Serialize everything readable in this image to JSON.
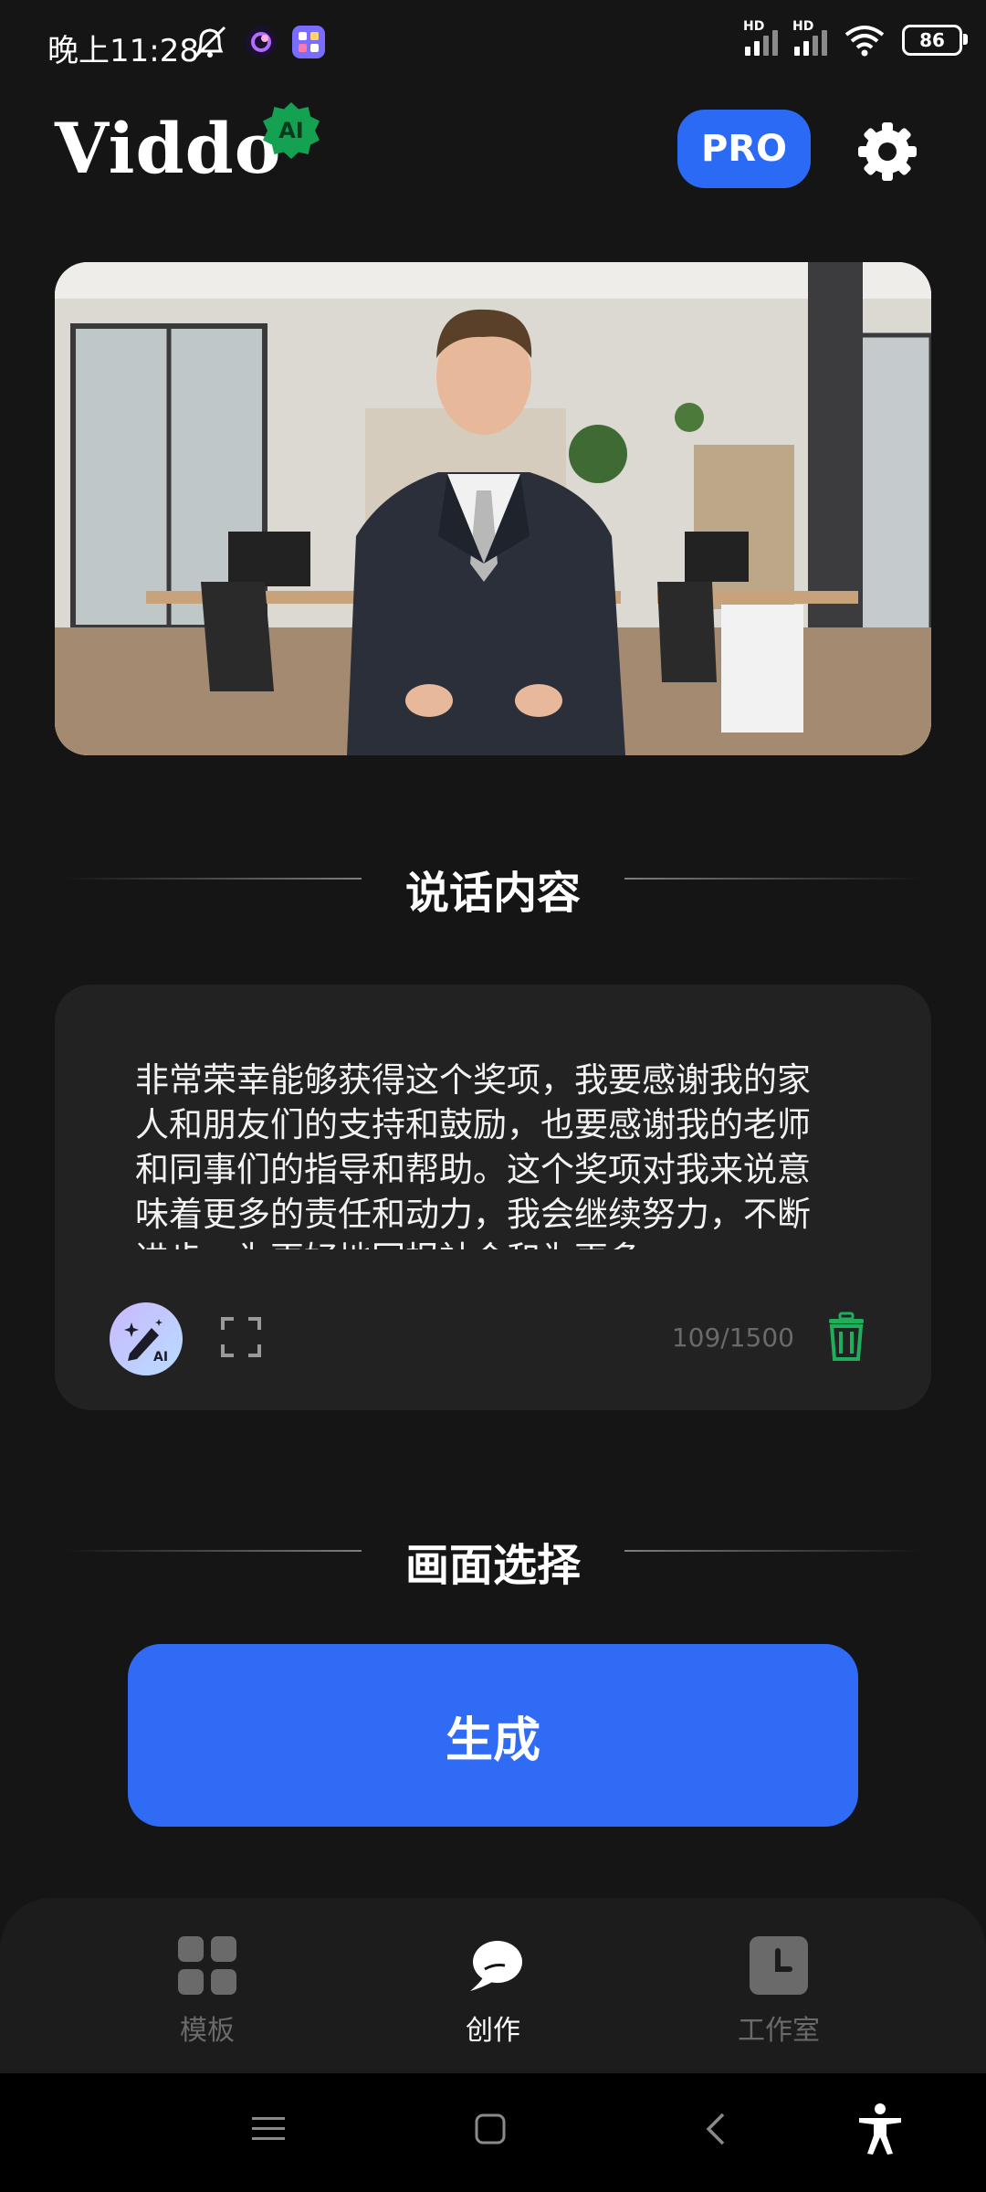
{
  "status_bar": {
    "time": "晚上11:28",
    "hd_label": "HD",
    "battery": "86"
  },
  "header": {
    "logo": "Viddo",
    "logo_badge": "AI",
    "pro_label": "PRO"
  },
  "speech_section": {
    "title": "说话内容",
    "text": "非常荣幸能够获得这个奖项，我要感谢我的家人和朋友们的支持和鼓励，也要感谢我的老师和同事们的指导和帮助。这个奖项对我来说意味着更多的责任和动力，我会继续努力，不断进步，为更好地回报社会和为更多",
    "ai_edit_label": "AI",
    "char_count": "109/1500"
  },
  "scene_section": {
    "title": "画面选择"
  },
  "generate_button": {
    "label": "生成"
  },
  "bottom_nav": {
    "items": [
      {
        "label": "模板",
        "icon": "grid-icon",
        "active": false
      },
      {
        "label": "创作",
        "icon": "chat-bubble-icon",
        "active": true
      },
      {
        "label": "工作室",
        "icon": "clock-icon",
        "active": false
      }
    ]
  },
  "colors": {
    "background": "#151515",
    "accent_blue": "#2f6bf5",
    "badge_green": "#14a152",
    "trash_green": "#1fae5b"
  }
}
